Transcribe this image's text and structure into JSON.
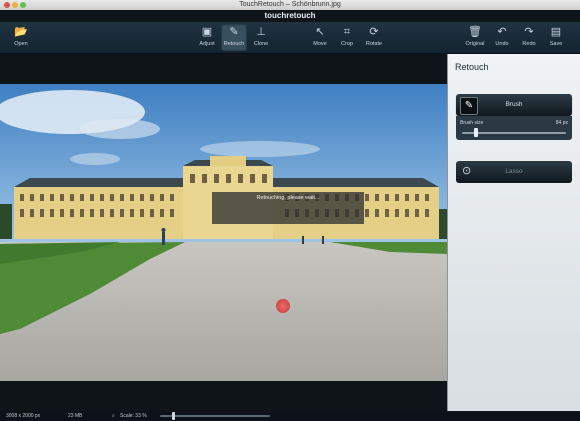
{
  "window": {
    "title": "TouchRetouch – Schönbrunn.jpg",
    "brand": "touchretouch"
  },
  "toolbar": {
    "open": "Open",
    "adjust": "Adjust",
    "retouch": "Retouch",
    "clone": "Clone",
    "move": "Move",
    "crop": "Crop",
    "rotate": "Rotate",
    "original": "Original",
    "undo": "Undo",
    "redo": "Redo",
    "save": "Save"
  },
  "canvas": {
    "status_message": "Retouching, please wait..."
  },
  "panel": {
    "title": "Retouch",
    "brush_label": "Brush",
    "brush_size_label": "Brush size",
    "brush_size_value": "84 px",
    "brush_size_fraction": 0.13,
    "lasso_label": "Lasso"
  },
  "statusbar": {
    "dimensions": "3008 x 2000 px",
    "filesize": "23 MB",
    "scale": "Scale: 33 %",
    "zoom_fraction": 0.12
  },
  "icons": {
    "open": "folder-icon",
    "adjust": "adjust-icon",
    "retouch": "brush-icon",
    "clone": "stamp-icon",
    "move": "cursor-icon",
    "crop": "crop-icon",
    "rotate": "rotate-icon",
    "original": "trash-icon",
    "undo": "undo-icon",
    "redo": "redo-icon",
    "save": "disk-icon",
    "lasso": "lasso-icon",
    "magnifier": "magnifier-icon"
  },
  "colors": {
    "accent_red": "#d64040",
    "toolbar": "#1f3340",
    "panel": "#e6ebee"
  }
}
